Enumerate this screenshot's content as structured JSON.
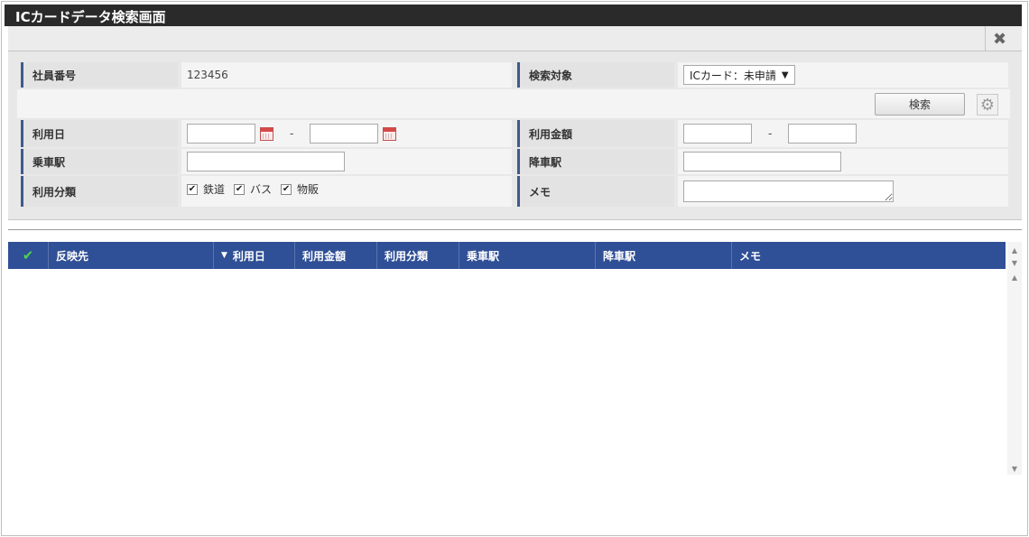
{
  "window": {
    "title": "ICカードデータ検索画面"
  },
  "form": {
    "employee_no_label": "社員番号",
    "employee_no_value": "123456",
    "target_label": "検索対象",
    "target_value": "ICカード：未申請",
    "search_button": "検索",
    "use_date_label": "利用日",
    "range_separator": "-",
    "amount_label": "利用金額",
    "board_station_label": "乗車駅",
    "alight_station_label": "降車駅",
    "category_label": "利用分類",
    "categories": [
      {
        "label": "鉄道",
        "checked": true
      },
      {
        "label": "バス",
        "checked": true
      },
      {
        "label": "物販",
        "checked": true
      }
    ],
    "memo_label": "メモ"
  },
  "table": {
    "columns": [
      "反映先",
      "利用日",
      "利用金額",
      "利用分類",
      "乗車駅",
      "降車駅",
      "メモ"
    ],
    "sort_column": "利用日",
    "sort_direction": "descending",
    "rows": []
  },
  "icons": {
    "close": "close-icon",
    "calendar": "calendar-icon",
    "gear": "gear-icon",
    "check": "check-icon"
  },
  "colors": {
    "title_bar": "#2a2a2a",
    "header_bg": "#2f4f96",
    "label_accent": "#3f5a8f",
    "check": "#4cd34c"
  }
}
